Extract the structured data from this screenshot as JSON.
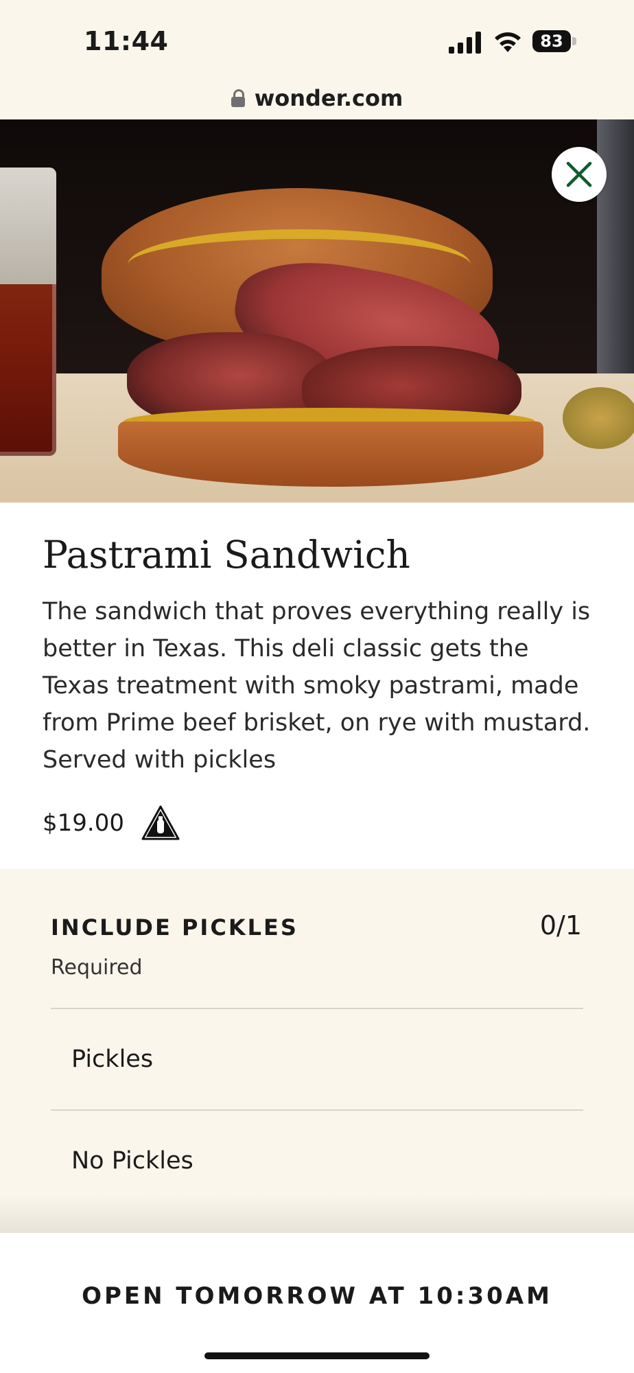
{
  "status": {
    "time": "11:44",
    "battery": "83"
  },
  "browser": {
    "url": "wonder.com"
  },
  "product": {
    "title": "Pastrami Sandwich",
    "description": "The sandwich that proves everything really is better in Texas. This deli classic gets the Texas treatment with smoky pastrami, made from Prime beef brisket, on rye with mustard. Served with pickles",
    "price": "$19.00",
    "allergen_icon": "allergen-warning-icon"
  },
  "modifier_group": {
    "title": "INCLUDE PICKLES",
    "count": "0/1",
    "required": "Required",
    "options": [
      {
        "label": "Pickles"
      },
      {
        "label": "No Pickles"
      }
    ]
  },
  "footer": {
    "status_label": "OPEN TOMORROW AT 10:30AM"
  },
  "colors": {
    "background": "#faf6ec",
    "close_icon": "#0f5a2c",
    "text": "#1b1b1b"
  }
}
